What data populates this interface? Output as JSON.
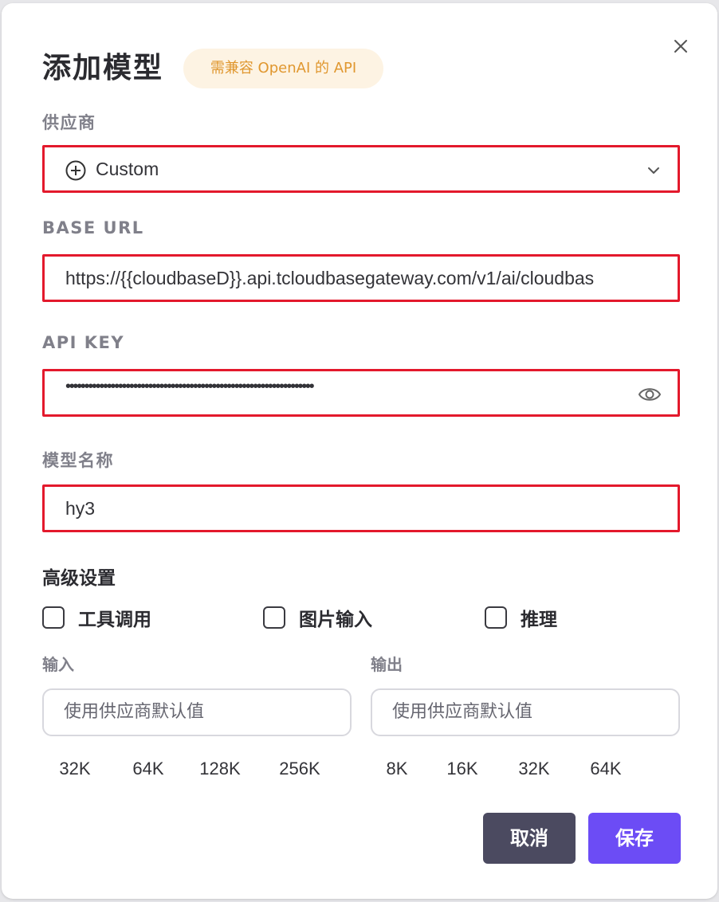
{
  "dialog": {
    "title": "添加模型",
    "badge": "需兼容 OpenAI 的 API"
  },
  "provider": {
    "label": "供应商",
    "value": "Custom"
  },
  "base_url": {
    "label": "BASE URL",
    "value": "https://{{cloudbaseD}}.api.tcloudbasegateway.com/v1/ai/cloudbas"
  },
  "api_key": {
    "label": "API KEY",
    "masked_value": "••••••••••••••••••••••••••••••••••••••••••••••••••••••••••••••••••"
  },
  "model_name": {
    "label": "模型名称",
    "value": "hy3"
  },
  "advanced": {
    "title": "高级设置",
    "options": [
      {
        "label": "工具调用",
        "checked": false
      },
      {
        "label": "图片输入",
        "checked": false
      },
      {
        "label": "推理",
        "checked": false
      }
    ],
    "input": {
      "label": "输入",
      "placeholder": "使用供应商默认值",
      "presets": [
        "32K",
        "64K",
        "128K",
        "256K"
      ]
    },
    "output": {
      "label": "输出",
      "placeholder": "使用供应商默认值",
      "presets": [
        "8K",
        "16K",
        "32K",
        "64K"
      ]
    }
  },
  "actions": {
    "cancel": "取消",
    "save": "保存"
  },
  "colors": {
    "highlight_border": "#e3192c",
    "badge_bg": "#fdf3e3",
    "badge_text": "#e0972f",
    "cancel_bg": "#4b4a60",
    "save_bg": "#6c4cf5"
  }
}
